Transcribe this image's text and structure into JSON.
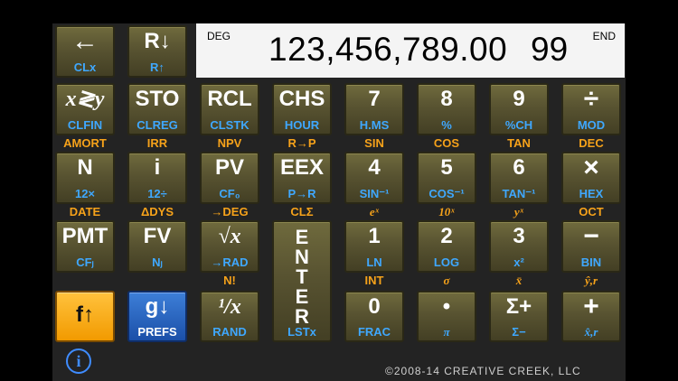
{
  "display": {
    "mode": "DEG",
    "value": "123,456,789.00",
    "counter": "99",
    "begin_end": "END"
  },
  "keys": {
    "clx": {
      "main": "←",
      "blue": "CLx"
    },
    "rdown": {
      "main": "R↓",
      "blue": "R↑"
    },
    "xy": {
      "main": "x≷y",
      "blue": "CLFIN",
      "gold": "AMORT"
    },
    "sto": {
      "main": "STO",
      "blue": "CLREG",
      "gold": "IRR"
    },
    "rcl": {
      "main": "RCL",
      "blue": "CLSTK",
      "gold": "NPV"
    },
    "chs": {
      "main": "CHS",
      "blue": "HOUR",
      "gold": "R→P"
    },
    "seven": {
      "main": "7",
      "blue": "H.MS",
      "gold": "SIN"
    },
    "eight": {
      "main": "8",
      "blue": "%",
      "gold": "COS"
    },
    "nine": {
      "main": "9",
      "blue": "%CH",
      "gold": "TAN"
    },
    "div": {
      "main": "÷",
      "blue": "MOD",
      "gold": "DEC"
    },
    "n": {
      "main": "N",
      "blue": "12×",
      "gold": "DATE"
    },
    "i": {
      "main": "i",
      "blue": "12÷",
      "gold": "ΔDYS"
    },
    "pv": {
      "main": "PV",
      "blue": "CF₀",
      "gold": "→DEG"
    },
    "eex": {
      "main": "EEX",
      "blue": "P→R",
      "gold": "CLΣ"
    },
    "four": {
      "main": "4",
      "blue": "SIN⁻¹",
      "gold": "eˣ"
    },
    "five": {
      "main": "5",
      "blue": "COS⁻¹",
      "gold": "10ˣ"
    },
    "six": {
      "main": "6",
      "blue": "TAN⁻¹",
      "gold": "yˣ"
    },
    "mul": {
      "main": "×",
      "blue": "HEX",
      "gold": "OCT"
    },
    "pmt": {
      "main": "PMT",
      "blue": "CFⱼ"
    },
    "fv": {
      "main": "FV",
      "blue": "Nⱼ"
    },
    "sqrt": {
      "main": "√x",
      "blue": "→RAD",
      "gold": "N!"
    },
    "enter": {
      "letters": [
        "E",
        "N",
        "T",
        "E",
        "R"
      ],
      "blue": "LSTx"
    },
    "one": {
      "main": "1",
      "blue": "LN",
      "gold": "INT"
    },
    "two": {
      "main": "2",
      "blue": "LOG",
      "gold": "σ"
    },
    "three": {
      "main": "3",
      "blue": "x²",
      "gold": "x̄"
    },
    "minus": {
      "main": "−",
      "blue": "BIN",
      "gold": "ŷ,r"
    },
    "f": {
      "main": "f↑"
    },
    "g": {
      "main": "g↓",
      "blue": "PREFS"
    },
    "recip": {
      "main": "¹/x",
      "blue": "RAND"
    },
    "zero": {
      "main": "0",
      "blue": "FRAC"
    },
    "dot": {
      "main": "•",
      "blue": "π"
    },
    "sigma": {
      "main": "Σ+",
      "blue": "Σ−"
    },
    "plus": {
      "main": "+",
      "blue": "x̂,r"
    }
  },
  "info_icon": "i",
  "copyright": "©2008-14 CREATIVE CREEK, LLC",
  "colors": {
    "gold": "#f6a21a",
    "blue_label": "#3fa8ff",
    "key": "#585331",
    "f_key": "#f29a00",
    "g_key": "#1b4fa8"
  }
}
